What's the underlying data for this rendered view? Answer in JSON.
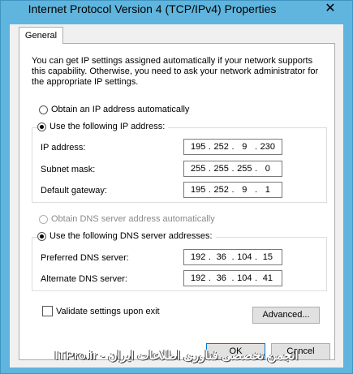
{
  "window": {
    "title": "Internet Protocol Version 4 (TCP/IPv4) Properties",
    "close_glyph": "✕"
  },
  "tabs": [
    {
      "label": "General"
    }
  ],
  "description": "You can get IP settings assigned automatically if your network supports this capability. Otherwise, you need to ask your network administrator for the appropriate IP settings.",
  "ip": {
    "auto_label": "Obtain an IP address automatically",
    "manual_label": "Use the following IP address:",
    "fields": [
      {
        "label": "IP address:",
        "octets": [
          "195",
          "252",
          "9",
          "230"
        ]
      },
      {
        "label": "Subnet mask:",
        "octets": [
          "255",
          "255",
          "255",
          "0"
        ]
      },
      {
        "label": "Default gateway:",
        "octets": [
          "195",
          "252",
          "9",
          "1"
        ]
      }
    ]
  },
  "dns": {
    "auto_label": "Obtain DNS server address automatically",
    "manual_label": "Use the following DNS server addresses:",
    "fields": [
      {
        "label": "Preferred DNS server:",
        "octets": [
          "192",
          "36",
          "104",
          "15"
        ]
      },
      {
        "label": "Alternate DNS server:",
        "octets": [
          "192",
          "36",
          "104",
          "41"
        ]
      }
    ]
  },
  "validate_label": "Validate settings upon exit",
  "buttons": {
    "advanced": "Advanced...",
    "ok": "OK",
    "cancel": "Cancel"
  },
  "watermark": "ITPro.ir - انجمن تخصصی فناوری اطلاعات ایران"
}
